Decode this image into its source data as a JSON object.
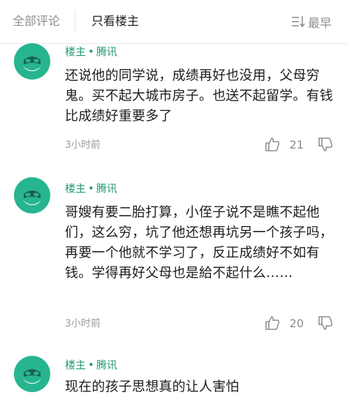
{
  "tabs": {
    "all": "全部评论",
    "op_only": "只看楼主",
    "sort": "最早"
  },
  "comments": [
    {
      "author": "楼主",
      "source": "腾讯",
      "text": "还说他的同学说，成绩再好也没用，父母穷鬼。买不起大城市房子。也送不起留学。有钱比成绩好重要多了",
      "time": "3小时前",
      "likes": "21"
    },
    {
      "author": "楼主",
      "source": "腾讯",
      "text": "哥嫂有要二胎打算，小侄子说不是瞧不起他们，这么穷，坑了他还想再坑另一个孩子吗，再要一个他就不学习了，反正成绩好不如有钱。学得再好父母也是給不起什么……",
      "time": "3小时前",
      "likes": "20"
    },
    {
      "author": "楼主",
      "source": "腾讯",
      "text": "现在的孩子思想真的让人害怕"
    }
  ],
  "colors": {
    "accent": "#1f9a76",
    "avatar_bg": "#27b58f"
  }
}
